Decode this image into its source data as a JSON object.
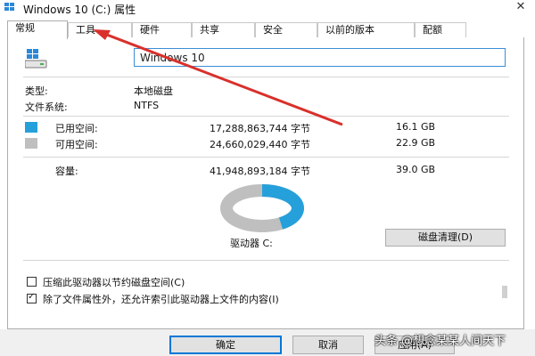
{
  "window": {
    "title": "Windows 10 (C:) 属性",
    "close_glyph": "✕"
  },
  "tabs": [
    {
      "label": "常规",
      "active": true
    },
    {
      "label": "工具",
      "active": false
    },
    {
      "label": "硬件",
      "active": false
    },
    {
      "label": "共享",
      "active": false
    },
    {
      "label": "安全",
      "active": false
    },
    {
      "label": "以前的版本",
      "active": false
    },
    {
      "label": "配额",
      "active": false
    }
  ],
  "general": {
    "drive_name_value": "Windows 10",
    "type_label": "类型:",
    "type_value": "本地磁盘",
    "fs_label": "文件系统:",
    "fs_value": "NTFS",
    "used": {
      "label": "已用空间:",
      "bytes": "17,288,863,744 字节",
      "size": "16.1 GB",
      "color": "#26a0da"
    },
    "free": {
      "label": "可用空间:",
      "bytes": "24,660,029,440 字节",
      "size": "22.9 GB",
      "color": "#bfbfbf"
    },
    "capacity": {
      "label": "容量:",
      "bytes": "41,948,893,184 字节",
      "size": "39.0 GB"
    },
    "drive_label": "驱动器 C:",
    "clean_button": "磁盘清理(D)",
    "used_fraction": 0.412,
    "compress_label": "压缩此驱动器以节约磁盘空间(C)",
    "compress_checked": false,
    "index_label": "除了文件属性外，还允许索引此驱动器上文件的内容(I)",
    "index_checked": true
  },
  "buttons": {
    "ok": "确定",
    "cancel": "取消",
    "apply": "应用(A)"
  },
  "watermark": "头条 @想念某某人间天下",
  "colors": {
    "accent": "#0078d7",
    "arrow": "#d9302b"
  }
}
